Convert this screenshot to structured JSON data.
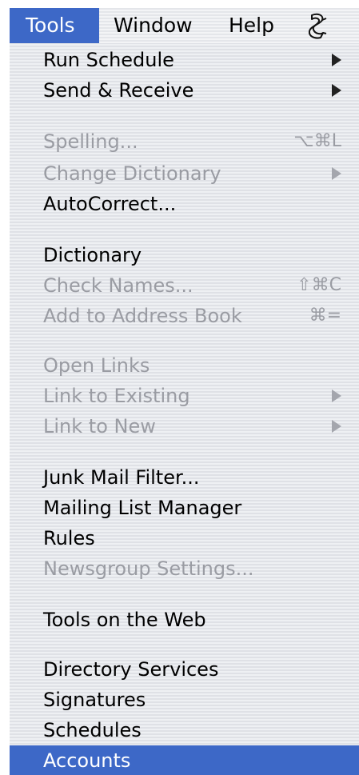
{
  "menubar": {
    "tools": "Tools",
    "window": "Window",
    "help": "Help",
    "script_icon": "script-menu-icon"
  },
  "menu": {
    "run_schedule": "Run Schedule",
    "send_receive": "Send & Receive",
    "spelling": "Spelling...",
    "spelling_shortcut": "⌥⌘L",
    "change_dictionary": "Change Dictionary",
    "autocorrect": "AutoCorrect...",
    "dictionary": "Dictionary",
    "check_names": "Check Names...",
    "check_names_shortcut": "⇧⌘C",
    "add_to_address_book": "Add to Address Book",
    "add_to_address_book_shortcut": "⌘=",
    "open_links": "Open Links",
    "link_to_existing": "Link to Existing",
    "link_to_new": "Link to New",
    "junk_mail_filter": "Junk Mail Filter...",
    "mailing_list_manager": "Mailing List Manager",
    "rules": "Rules",
    "newsgroup_settings": "Newsgroup Settings...",
    "tools_on_the_web": "Tools on the Web",
    "directory_services": "Directory Services",
    "signatures": "Signatures",
    "schedules": "Schedules",
    "accounts": "Accounts"
  },
  "colors": {
    "highlight": "#3d68c7",
    "disabled_text": "#9a9ca3",
    "menu_background": "#e7e9ed"
  }
}
